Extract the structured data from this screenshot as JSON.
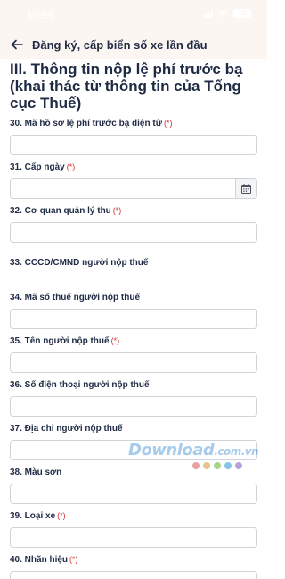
{
  "status_bar": {
    "time": "10:55",
    "battery": "76",
    "colors": {
      "icons": "#ffffff",
      "background": "#fbf6f1"
    }
  },
  "header": {
    "title": "Đăng ký, cấp biển số xe lần đầu",
    "back_icon": "arrow-left-icon"
  },
  "section": {
    "title": "III. Thông tin nộp lệ phí trước bạ (khai thác từ thông tin của Tổng cục Thuế)"
  },
  "required_mark": "(*)",
  "fields": [
    {
      "label": "30. Mã hồ sơ lệ phí trước bạ điện tử",
      "required": true,
      "value": ""
    },
    {
      "label": "31. Cấp ngày",
      "required": true,
      "value": "",
      "icon": "calendar-icon"
    },
    {
      "label": "32. Cơ quan quản lý thu",
      "required": true,
      "value": ""
    },
    {
      "label": "33. CCCD/CMND người nộp thuế",
      "required": false,
      "value": ""
    },
    {
      "label": "34. Mã số thuế người nộp thuế",
      "required": false,
      "value": ""
    },
    {
      "label": "35. Tên người nộp thuế",
      "required": true,
      "value": ""
    },
    {
      "label": "36. Số điện thoại người nộp thuế",
      "required": false,
      "value": ""
    },
    {
      "label": "37. Địa chỉ người nộp thuế",
      "required": false,
      "value": ""
    },
    {
      "label": "38. Màu sơn",
      "required": false,
      "value": ""
    },
    {
      "label": "39. Loại xe",
      "required": true,
      "value": ""
    },
    {
      "label": "40. Nhãn hiệu",
      "required": true,
      "value": ""
    }
  ],
  "watermark": {
    "text": "Download",
    "domain": ".com.vn",
    "dot_colors": [
      "#e8a0a0",
      "#e8c48a",
      "#a8d48a",
      "#8ac4e8",
      "#b8a0e0"
    ]
  },
  "colors": {
    "accent_required": "#d62d2d",
    "text": "#1f2a44",
    "border": "#cfd3da"
  }
}
